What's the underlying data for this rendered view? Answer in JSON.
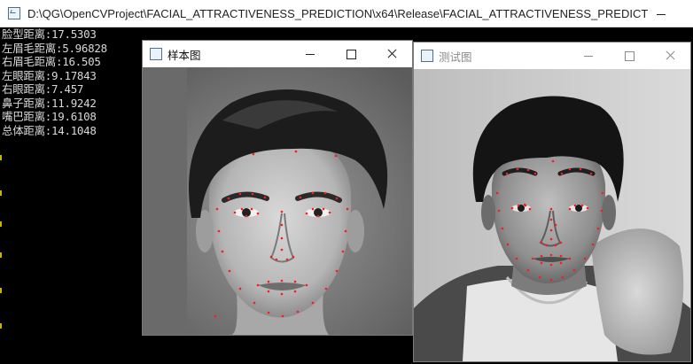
{
  "console": {
    "title": "D:\\QG\\OpenCVProject\\FACIAL_ATTRACTIVENESS_PREDICTION\\x64\\Release\\FACIAL_ATTRACTIVENESS_PREDICTION.e...",
    "lines": [
      "脸型距离:17.5303",
      "左眉毛距离:5.96828",
      "右眉毛距离:16.505",
      "左眼距离:9.17843",
      "右眼距离:7.457",
      "鼻子距离:11.9242",
      "嘴巴距离:19.6108",
      "总体距离:14.1048"
    ]
  },
  "sample_window": {
    "title": "样本图",
    "icon": "app-window-icon"
  },
  "test_window": {
    "title": "测试图",
    "icon": "app-window-icon"
  },
  "colors": {
    "console_bg": "#000000",
    "console_text": "#d8d8d8",
    "landmark": "#ff1a1a"
  }
}
